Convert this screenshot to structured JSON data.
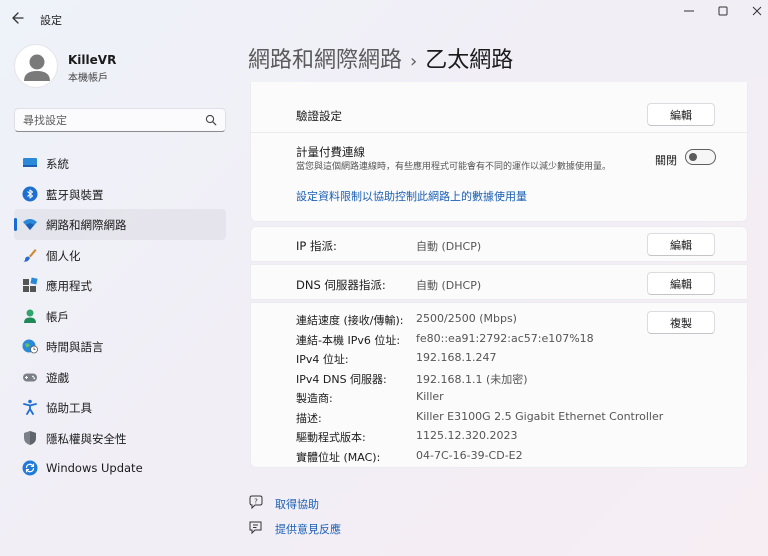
{
  "window": {
    "title": "設定"
  },
  "profile": {
    "name": "KilleVR",
    "subtitle": "本機帳戶"
  },
  "search": {
    "placeholder": "尋找設定"
  },
  "nav": {
    "items": [
      {
        "label": "系統",
        "icon": "system-icon"
      },
      {
        "label": "藍牙與裝置",
        "icon": "bluetooth-icon"
      },
      {
        "label": "網路和網際網路",
        "icon": "wifi-icon",
        "active": true
      },
      {
        "label": "個人化",
        "icon": "brush-icon"
      },
      {
        "label": "應用程式",
        "icon": "apps-icon"
      },
      {
        "label": "帳戶",
        "icon": "account-icon"
      },
      {
        "label": "時間與語言",
        "icon": "globe-clock-icon"
      },
      {
        "label": "遊戲",
        "icon": "gamepad-icon"
      },
      {
        "label": "協助工具",
        "icon": "accessibility-icon"
      },
      {
        "label": "隱私權與安全性",
        "icon": "shield-icon"
      },
      {
        "label": "Windows Update",
        "icon": "windows-update-icon"
      }
    ]
  },
  "breadcrumb": {
    "parent": "網路和網際網路",
    "separator": "›",
    "current": "乙太網路"
  },
  "auth": {
    "label": "驗證設定",
    "button": "編輯"
  },
  "metered": {
    "label": "計量付費連線",
    "description": "當您與這個網路連線時，有些應用程式可能會有不同的運作以減少數據使用量。",
    "toggle_text": "關閉",
    "toggle_on": false,
    "link": "設定資料限制以協助控制此網路上的數據使用量"
  },
  "ip": {
    "label": "IP 指派:",
    "value": "自動 (DHCP)",
    "button": "編輯"
  },
  "dns": {
    "label": "DNS 伺服器指派:",
    "value": "自動 (DHCP)",
    "button": "編輯"
  },
  "properties": {
    "copy_button": "複製",
    "rows": [
      {
        "label": "連結速度 (接收/傳輸):",
        "value": "2500/2500 (Mbps)"
      },
      {
        "label": "連結-本機 IPv6 位址:",
        "value": "fe80::ea91:2792:ac57:e107%18"
      },
      {
        "label": "IPv4 位址:",
        "value": "192.168.1.247"
      },
      {
        "label": "IPv4 DNS 伺服器:",
        "value": "192.168.1.1 (未加密)"
      },
      {
        "label": "製造商:",
        "value": "Killer"
      },
      {
        "label": "描述:",
        "value": "Killer E3100G 2.5 Gigabit Ethernet Controller"
      },
      {
        "label": "驅動程式版本:",
        "value": "1125.12.320.2023"
      },
      {
        "label": "實體位址 (MAC):",
        "value": "04-7C-16-39-CD-E2"
      }
    ]
  },
  "help": {
    "get_help": "取得協助",
    "feedback": "提供意見反應"
  },
  "colors": {
    "accent": "#1a6ad8",
    "link": "#1a5fb4"
  }
}
